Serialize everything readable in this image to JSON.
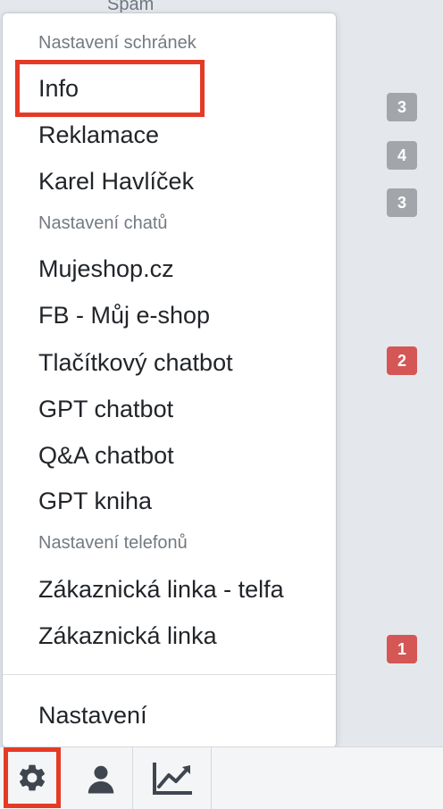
{
  "background": {
    "spam_label": "Spam",
    "badges": [
      "3",
      "4",
      "3",
      "2",
      "1"
    ]
  },
  "menu": {
    "sections": [
      {
        "header": "Nastavení schránek",
        "items": [
          "Info",
          "Reklamace",
          "Karel Havlíček"
        ]
      },
      {
        "header": "Nastavení chatů",
        "items": [
          "Mujeshop.cz",
          "FB - Můj e-shop",
          "Tlačítkový chatbot",
          "GPT chatbot",
          "Q&A chatbot",
          "GPT kniha"
        ]
      },
      {
        "header": "Nastavení telefonů",
        "items": [
          "Zákaznická linka - telfa",
          "Zákaznická linka"
        ]
      }
    ],
    "footer_item": "Nastavení"
  },
  "bottom_bar": {
    "icons": [
      "gear-icon",
      "user-icon",
      "trend-chart-icon"
    ]
  },
  "colors": {
    "highlight": "#e53a26",
    "badge_grey": "#a2a6ab",
    "badge_red": "#d45755",
    "icon": "#3f4650"
  }
}
